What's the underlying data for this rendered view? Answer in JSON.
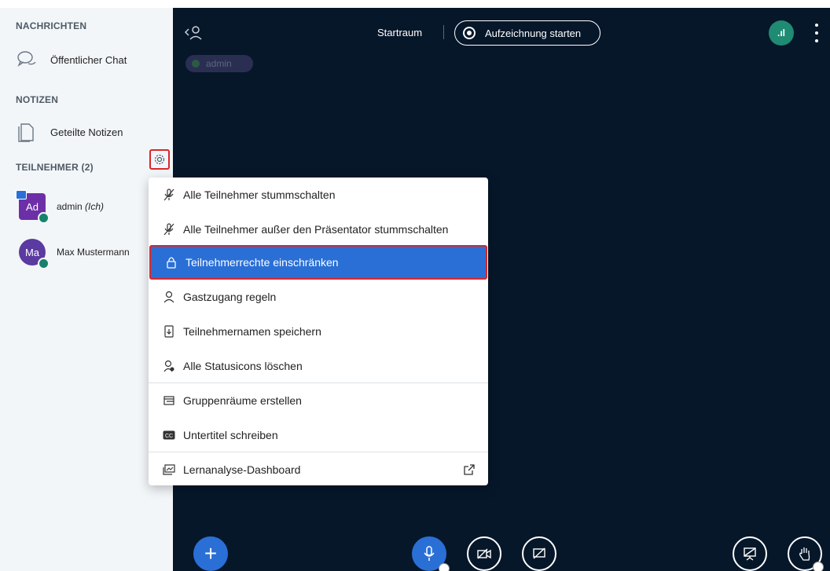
{
  "sidebar": {
    "messages_heading": "NACHRICHTEN",
    "public_chat_label": "Öffentlicher Chat",
    "notes_heading": "NOTIZEN",
    "shared_notes_label": "Geteilte Notizen",
    "participants_heading": "TEILNEHMER (2)",
    "users": [
      {
        "initials": "Ad",
        "name": "admin",
        "suffix": "(Ich)"
      },
      {
        "initials": "Ma",
        "name": "Max Mustermann"
      }
    ]
  },
  "topbar": {
    "room_name": "Startraum",
    "record_label": "Aufzeichnung starten",
    "connection_label": ".ıl"
  },
  "talking_indicator": {
    "name": "admin"
  },
  "menu": {
    "items": [
      {
        "label": "Alle Teilnehmer stummschalten",
        "icon": "mic-off-icon"
      },
      {
        "label": "Alle Teilnehmer außer den Präsentator stummschalten",
        "icon": "mic-off-icon"
      },
      {
        "label": "Teilnehmerrechte einschränken",
        "icon": "lock-icon",
        "selected": true
      },
      {
        "label": "Gastzugang regeln",
        "icon": "user-icon"
      },
      {
        "label": "Teilnehmernamen speichern",
        "icon": "download-file-icon"
      },
      {
        "label": "Alle Statusicons löschen",
        "icon": "user-clear-icon"
      },
      {
        "label": "Gruppenräume erstellen",
        "icon": "rooms-icon"
      },
      {
        "label": "Untertitel schreiben",
        "icon": "closed-caption-icon"
      },
      {
        "label": "Lernanalyse-Dashboard",
        "icon": "dashboard-icon"
      }
    ]
  },
  "bottombar": {
    "plus_label": "+"
  },
  "colors": {
    "sidebar_bg": "#f3f6f9",
    "main_bg": "#06172a",
    "accent_blue": "#2a6fd6",
    "highlight_red": "#d9272e",
    "connection_green": "#1f8b73"
  }
}
